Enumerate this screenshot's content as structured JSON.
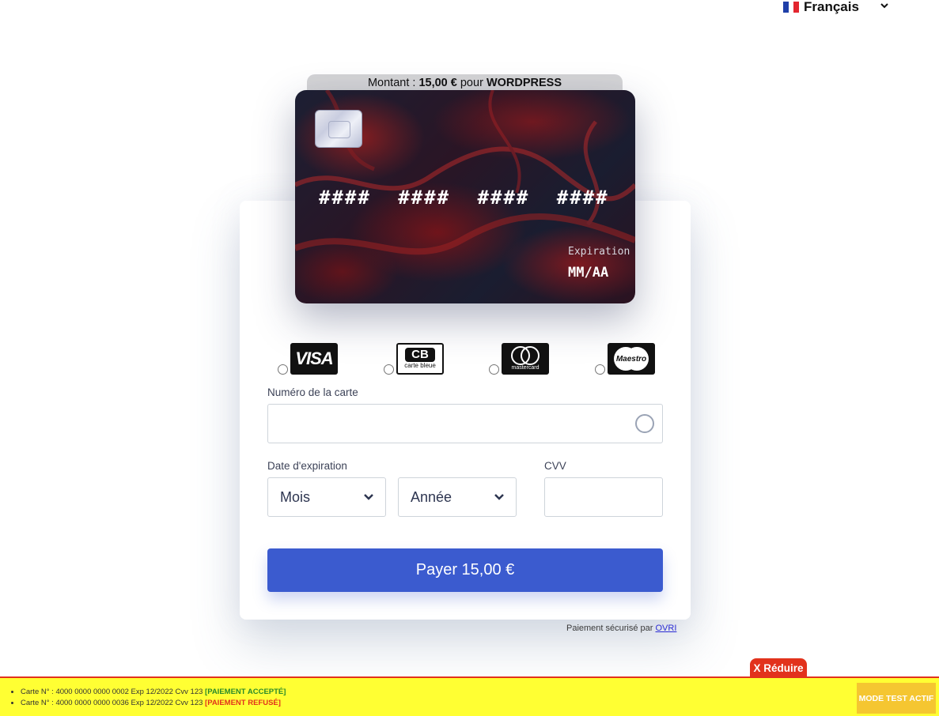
{
  "language": {
    "selected": "Français",
    "flag_colors": [
      "#1f3fa8",
      "#ffffff",
      "#e3262f"
    ],
    "chevron_icon": "chevron-down-icon"
  },
  "amount": {
    "prefix": "Montant : ",
    "value": "15,00 €",
    "middle": " pour ",
    "merchant": "WORDPRESS"
  },
  "card_preview": {
    "number": "#### #### #### ####",
    "expiration_label": "Expiration",
    "expiration_value": "MM/AA"
  },
  "brands": [
    {
      "name": "VISA"
    },
    {
      "name": "CB",
      "sub": "carte bleue"
    },
    {
      "name": "mastercard"
    },
    {
      "name": "Maestro"
    }
  ],
  "form": {
    "card_number_label": "Numéro de la carte",
    "card_number_value": "",
    "expiry_label": "Date d'expiration",
    "month_placeholder": "Mois",
    "year_placeholder": "Année",
    "cvv_label": "CVV",
    "cvv_value": ""
  },
  "pay_button": "Payer 15,00 €",
  "footer": {
    "secure_text": "Paiement sécurisé par ",
    "secure_link": "OVRI"
  },
  "test_mode": {
    "reduce_button": "X Réduire",
    "lines": [
      {
        "text": "Carte N° : 4000 0000 0000 0002 Exp 12/2022 Cvv 123 ",
        "status": "[PAIEMENT ACCEPTÉ]"
      },
      {
        "text": "Carte N° : 4000 0000 0000 0036 Exp 12/2022 Cvv 123 ",
        "status": "[PAIEMENT REFUSÉ]"
      }
    ],
    "badge": "MODE TEST ACTIF",
    "colors": {
      "banner": "#ffff33",
      "accent": "#e2321c",
      "badge": "#f5c631",
      "accepted": "#2a8a2a"
    }
  },
  "accent_color": "#3b5bcf"
}
